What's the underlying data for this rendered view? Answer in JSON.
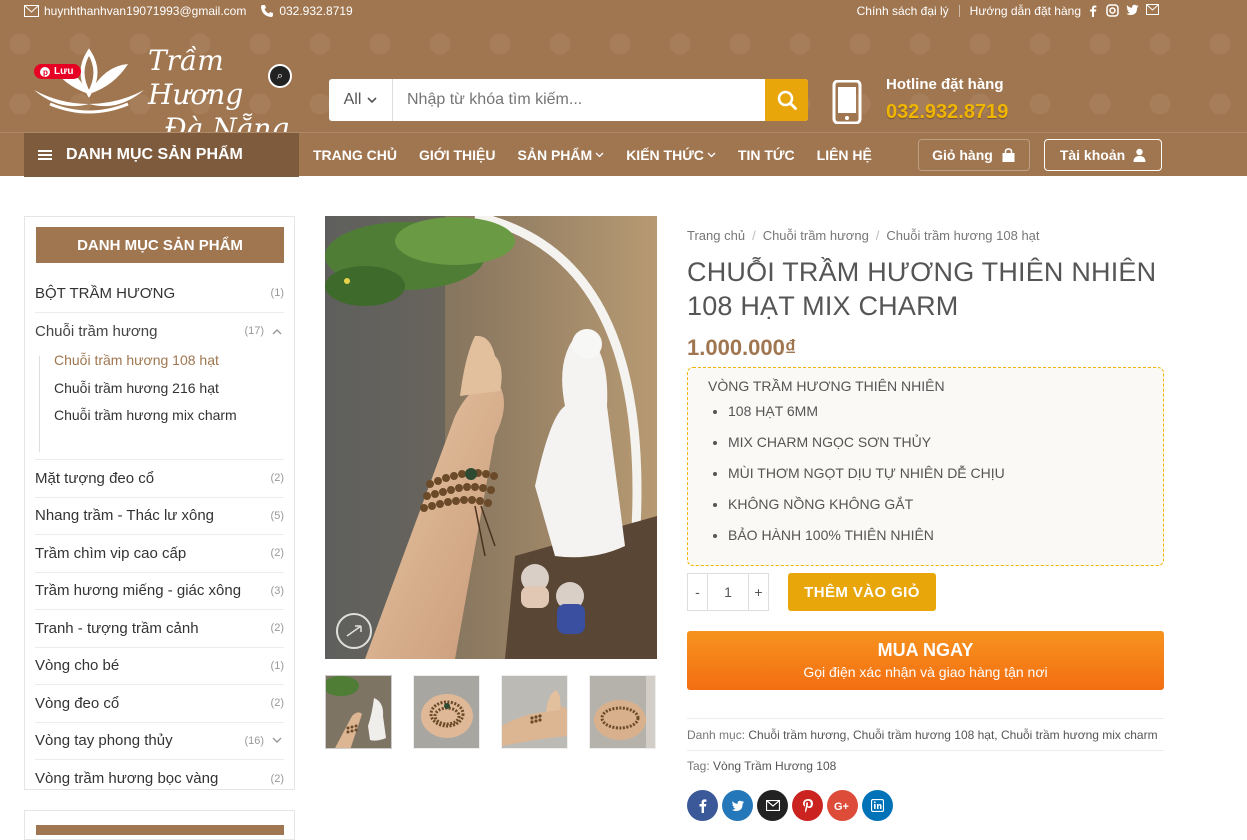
{
  "topbar": {
    "email": "huynhthanhvan19071993@gmail.com",
    "phone": "032.932.8719",
    "links": [
      "Chính sách đại lý",
      "Hướng dẫn đặt hàng"
    ],
    "social_icons": [
      "facebook-icon",
      "instagram-icon",
      "twitter-icon",
      "mail-icon"
    ]
  },
  "header": {
    "logo_line1": "Trầm Hương",
    "logo_line2": "Đà Nẵng",
    "pinterest_label": "Lưu",
    "search": {
      "category": "All",
      "placeholder": "Nhập từ khóa tìm kiếm..."
    },
    "hotline_label": "Hotline đặt hàng",
    "hotline_number": "032.932.8719"
  },
  "nav": {
    "category_button": "DANH MỤC SẢN PHẨM",
    "items": [
      "TRANG CHỦ",
      "GIỚI THIỆU",
      "SẢN PHẨM",
      "KIẾN THỨC",
      "TIN TỨC",
      "LIÊN HỆ"
    ],
    "cart_label": "Giỏ hàng",
    "account_label": "Tài khoản"
  },
  "sidebar": {
    "title": "DANH MỤC SẢN PHẨM",
    "items": [
      {
        "label": "BỘT TRẦM HƯƠNG",
        "count": "(1)"
      },
      {
        "label": "Chuỗi trầm hương",
        "count": "(17)"
      },
      {
        "label": "Mặt tượng đeo cổ",
        "count": "(2)"
      },
      {
        "label": "Nhang trầm - Thác lư xông",
        "count": "(5)"
      },
      {
        "label": "Trầm chìm vip cao cấp",
        "count": "(2)"
      },
      {
        "label": "Trầm hương miếng - giác xông",
        "count": "(3)"
      },
      {
        "label": "Tranh - tượng trầm cảnh",
        "count": "(2)"
      },
      {
        "label": "Vòng cho bé",
        "count": "(1)"
      },
      {
        "label": "Vòng đeo cổ",
        "count": "(2)"
      },
      {
        "label": "Vòng tay phong thủy",
        "count": "(16)"
      },
      {
        "label": "Vòng trầm hương bọc vàng",
        "count": "(2)"
      }
    ],
    "sub_items": [
      "Chuỗi trầm hương 108 hạt",
      "Chuỗi trầm hương 216 hạt",
      "Chuỗi trầm hương mix charm"
    ]
  },
  "product": {
    "breadcrumb": [
      "Trang chủ",
      "Chuỗi trầm hương",
      "Chuỗi trầm hương 108 hạt"
    ],
    "title": "CHUỖI TRẦM HƯƠNG THIÊN NHIÊN 108 HẠT MIX CHARM",
    "price": "1.000.000₫",
    "desc_heading": "VÒNG TRẦM HƯƠNG THIÊN NHIÊN",
    "features": [
      "108 HẠT 6MM",
      "MIX CHARM NGỌC SƠN THỦY",
      "MÙI THƠM NGỌT DỊU TỰ NHIÊN DỄ CHỊU",
      "KHÔNG NỒNG KHÔNG GẮT",
      "BẢO HÀNH 100% THIÊN NHIÊN"
    ],
    "qty_minus": "-",
    "qty_value": "1",
    "qty_plus": "+",
    "add_to_cart": "THÊM VÀO GIỎ",
    "buy_now_title": "MUA NGAY",
    "buy_now_sub": "Gọi điện xác nhận và giao hàng tận nơi",
    "category_label": "Danh mục:",
    "categories": "Chuỗi trầm hương, Chuỗi trầm hương 108 hạt, Chuỗi trầm hương mix charm",
    "tag_label": "Tag:",
    "tags": "Vòng Trầm Hương 108"
  },
  "share_icons": [
    "facebook-icon",
    "twitter-icon",
    "email-icon",
    "pinterest-icon",
    "google-plus-icon",
    "linkedin-icon"
  ],
  "colors": {
    "brand": "#a07650",
    "brand_dark": "#7e5b3c",
    "accent": "#e8a60a",
    "buy": "#f36e12"
  }
}
